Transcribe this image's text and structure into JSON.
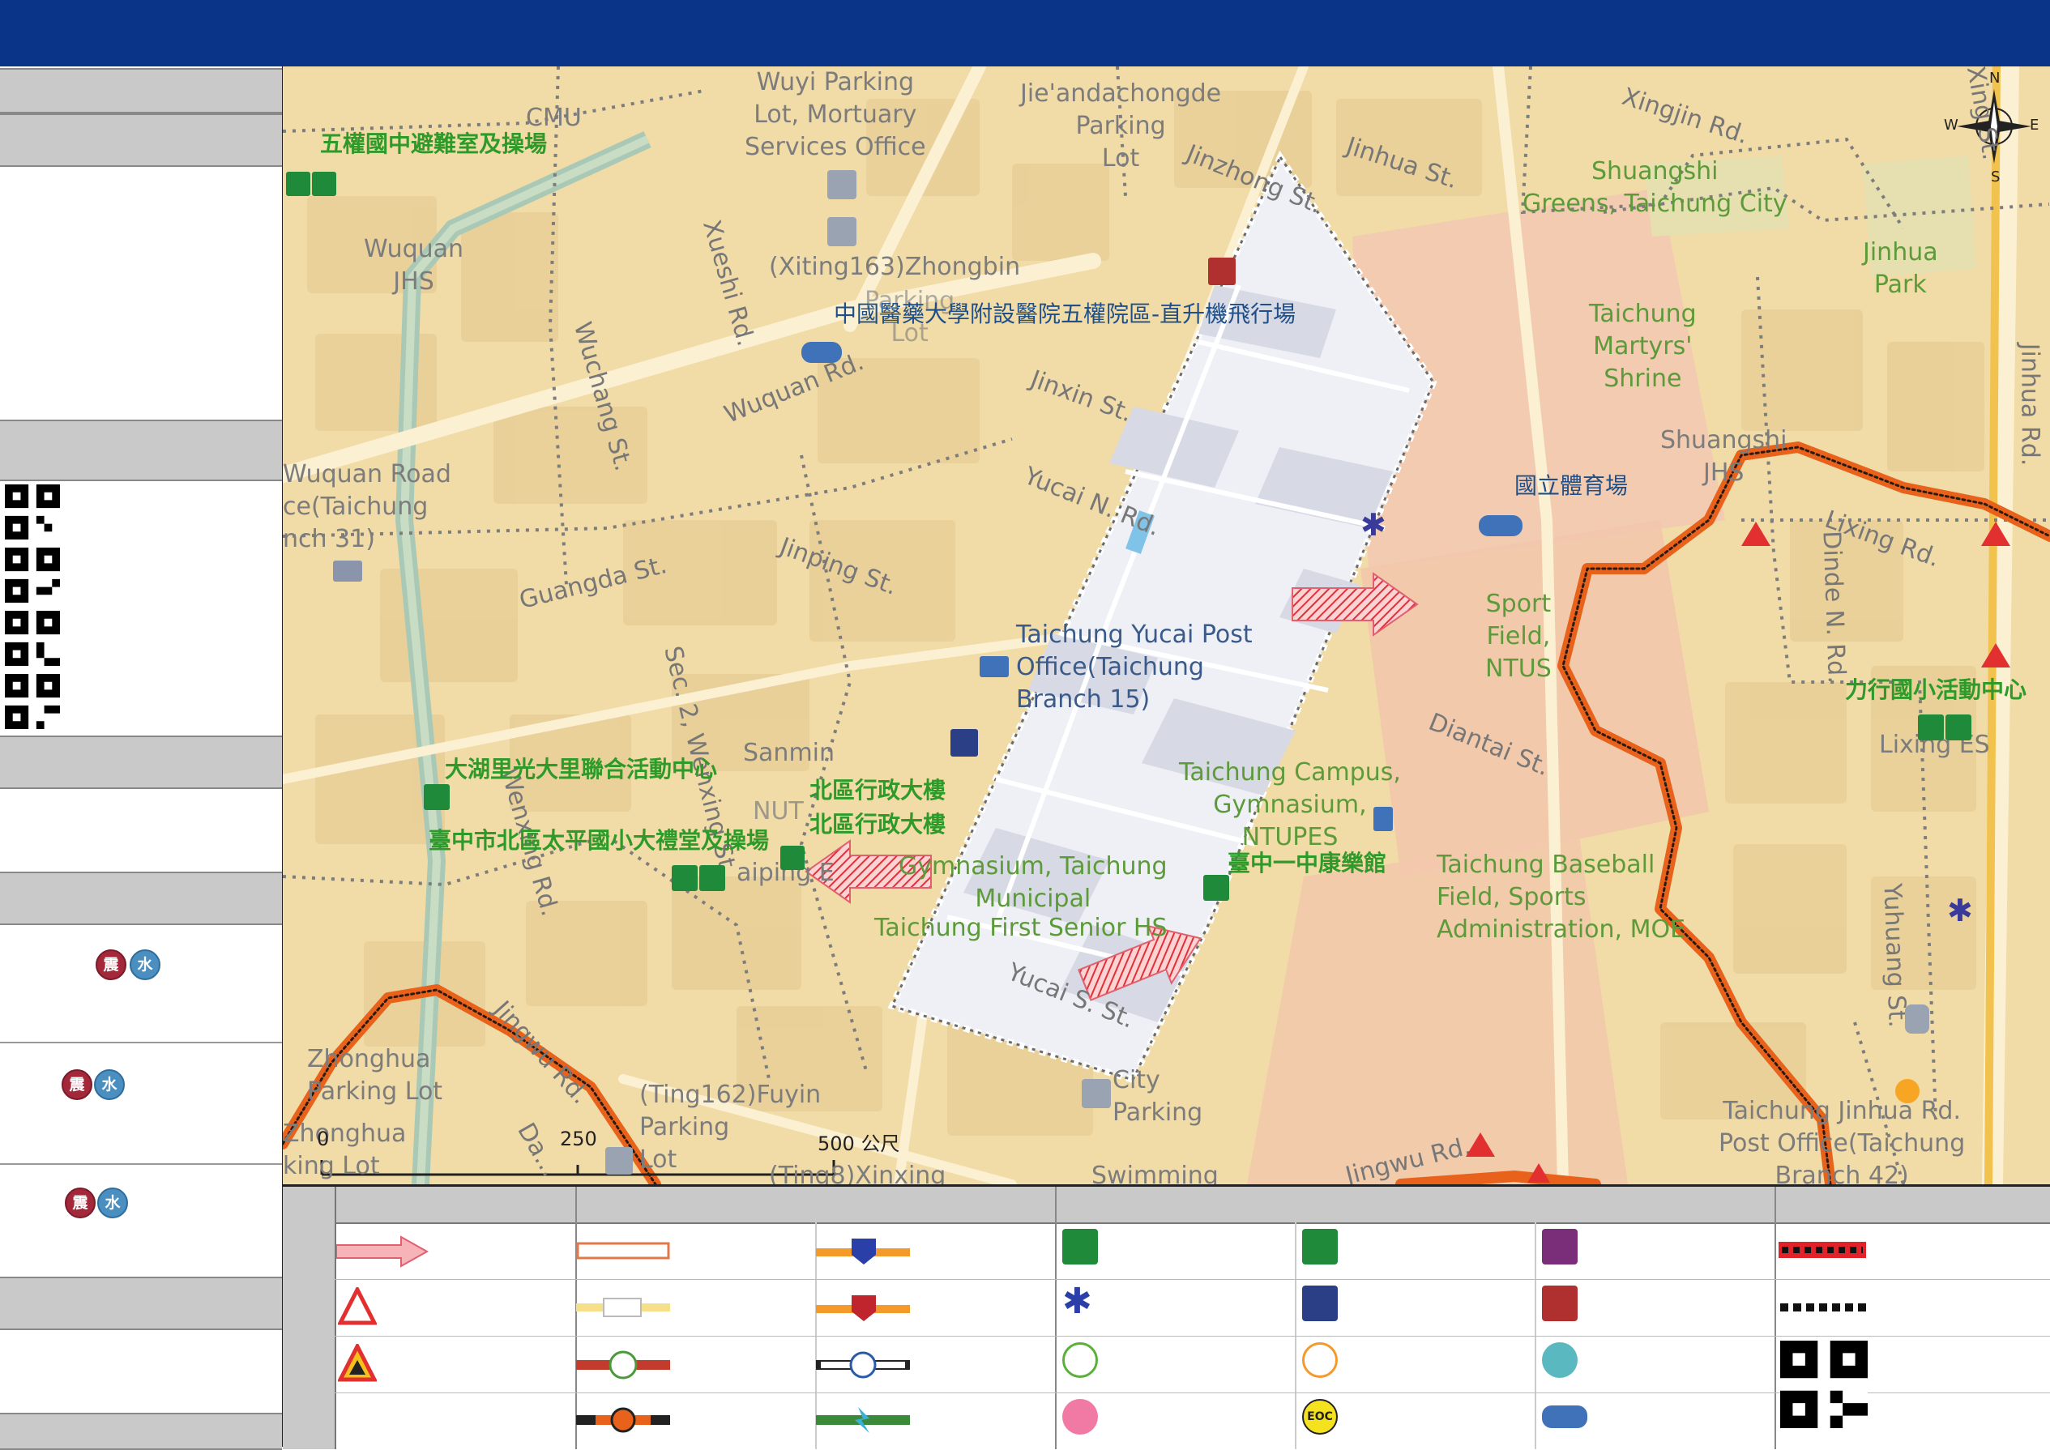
{
  "map": {
    "scale": {
      "labels": [
        "0",
        "250",
        "500 公尺"
      ]
    },
    "compass": {
      "n": "N",
      "s": "S",
      "e": "E",
      "w": "W"
    },
    "streets": [
      "Xingjin Rd.",
      "Jinhua St.",
      "Jinzhong St.",
      "Jinxin St.",
      "Yucai N. Rd.",
      "Lixing Rd.",
      "Diantai St.",
      "Jinping St.",
      "Guangda St.",
      "Wuquan Rd.",
      "Xueshi Rd.",
      "Wuchang St.",
      "Sec. 2, Wenxing St.",
      "Wenxing Rd.",
      "Jingwu Rd.",
      "Yucai S. St.",
      "Jinhua Rd.",
      "Dinde N. Rd.",
      "Yuhuang St.",
      "Xing St.",
      "Da...",
      "Jingwu Rd."
    ],
    "places": {
      "cmu": "CMU",
      "wuyi": "Wuyi Parking\nLot, Mortuary\nServices Office",
      "jiean": "Jie'andachongde\nParking\nLot",
      "wuquan_jhs": "Wuquan\nJHS",
      "xiting": "(Xiting163)Zhongbin",
      "parking_lot": "Parking\nLot",
      "shuangshi_greens": "Shuangshi\nGreens, Taichung City",
      "jinhua_park": "Jinhua\nPark",
      "martyrs": "Taichung\nMartyrs'\nShrine",
      "shuangshi_jhs": "Shuangshi\nJHS",
      "wuquan_post": "Wuquan Road\nce(Taichung\nnch 31)",
      "yucai_post": "Taichung Yucai Post\nOffice(Taichung\nBranch 15)",
      "sport_field": "Sport\nField,\nNTUS",
      "sanmin": "Sanmin",
      "campus_ntupes": "Taichung Campus,\nGymnasium,\nNTUPES",
      "gym_municipal": "Gymnasium, Taichung\nMunicipal",
      "first_senior": "Taichung First Senior HS",
      "baseball": "Taichung Baseball\nField, Sports\nAdministration, MOE",
      "lixing_es": "Lixing ES",
      "zhonghua_parking": "Zhonghua\nParking Lot",
      "zhonghua2": "Zhonghua\nking Lot",
      "ting162": "(Ting162)Fuyin\nParking\nLot",
      "city_parking": "City\nParking",
      "swimming": "Swimming",
      "ting8": "(Ting8)Xinxing",
      "jinhua_post": "Taichung Jinhua Rd.\nPost Office(Taichung\nBranch 42)",
      "nut": "NUT",
      "taiping": "aiping E"
    },
    "shelters": {
      "wuquan_jhs": "五權國中避難室及操場",
      "dahu": "大湖里光大里聯合活動中心",
      "north_admin1": "北區行政大樓",
      "north_admin2": "北區行政大樓",
      "taiping_es": "臺中市北區太平國小大禮堂及操場",
      "yizhong": "臺中一中康樂館",
      "lixing": "力行國小活動中心"
    },
    "helipads": {
      "cmu_hospital": "中國醫藥大學附設醫院五權院區-直升機飛行場",
      "stadium": "國立體育場"
    }
  },
  "sidebar": {
    "qr_codes": 4,
    "badges": [
      {
        "quake": "震",
        "water": "水"
      },
      {
        "quake": "震",
        "water": "水"
      },
      {
        "quake": "震",
        "water": "水"
      }
    ]
  },
  "legend": {
    "eoc": "EOC"
  },
  "colors": {
    "header": "#0a3487",
    "boundary": "#e8621c",
    "shelter_green": "#1e8a3a",
    "area_fill": "#eef0f6"
  }
}
